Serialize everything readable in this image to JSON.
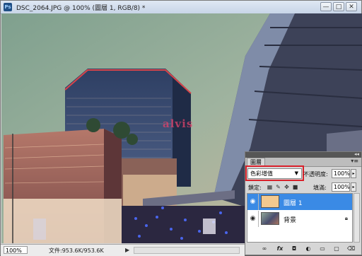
{
  "window": {
    "app_icon": "Ps",
    "title": "DSC_2064.JPG @ 100% (圖層 1, RGB/8) *",
    "minimize": "—",
    "maximize": "□",
    "close": "✕"
  },
  "canvas": {
    "watermark": "alvis"
  },
  "statusbar": {
    "zoom": "100%",
    "doc_info": "文件:953.6K/953.6K",
    "arrow": "▶"
  },
  "layers_panel": {
    "tab_label": "圖層",
    "blend_mode": "色彩增值",
    "opacity_label": "不透明度:",
    "opacity_value": "100%",
    "lock_label": "鎖定:",
    "fill_label": "填滿:",
    "fill_value": "100%",
    "layers": [
      {
        "name": "圖層 1",
        "selected": true,
        "thumb_color": "#f3c98f"
      },
      {
        "name": "背景",
        "selected": false,
        "locked": true
      }
    ]
  }
}
